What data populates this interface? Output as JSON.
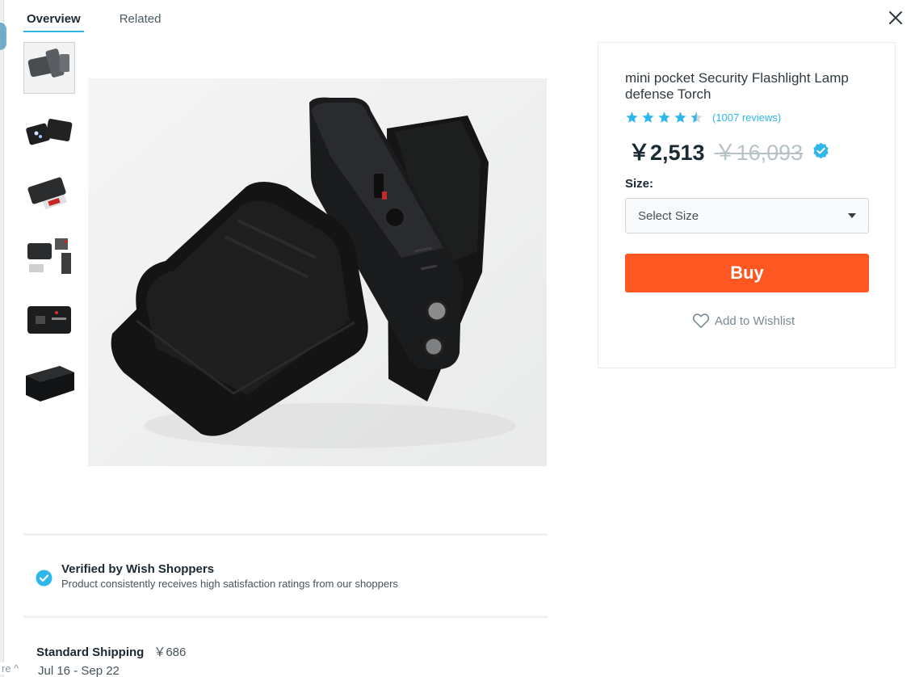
{
  "tabs": [
    {
      "label": "Overview",
      "active": true
    },
    {
      "label": "Related",
      "active": false
    }
  ],
  "close_icon": "close-icon",
  "thumbnails": [
    {
      "name": "thumb-1",
      "selected": true
    },
    {
      "name": "thumb-2",
      "selected": false
    },
    {
      "name": "thumb-3",
      "selected": false
    },
    {
      "name": "thumb-4",
      "selected": false
    },
    {
      "name": "thumb-5",
      "selected": false
    },
    {
      "name": "thumb-6",
      "selected": false
    }
  ],
  "product": {
    "title": "mini pocket Security Flashlight Lamp defense Torch",
    "rating": 4.5,
    "reviews_text": "(1007 reviews)",
    "price": "￥2,513",
    "original_price": "￥16,093",
    "size_label": "Size:",
    "size_placeholder": "Select Size",
    "buy_label": "Buy",
    "wishlist_label": "Add to Wishlist"
  },
  "verified": {
    "title": "Verified by Wish Shoppers",
    "description": "Product consistently receives high satisfaction ratings from our shoppers"
  },
  "shipping": {
    "label": "Standard Shipping",
    "price": "￥686",
    "dates": "Jul 16 - Sep 22"
  },
  "side_tab": {
    "label": "re ^"
  },
  "colors": {
    "accent_blue": "#2fb7ec",
    "buy_orange": "#ff5722",
    "star_blue": "#2fb7ec"
  }
}
